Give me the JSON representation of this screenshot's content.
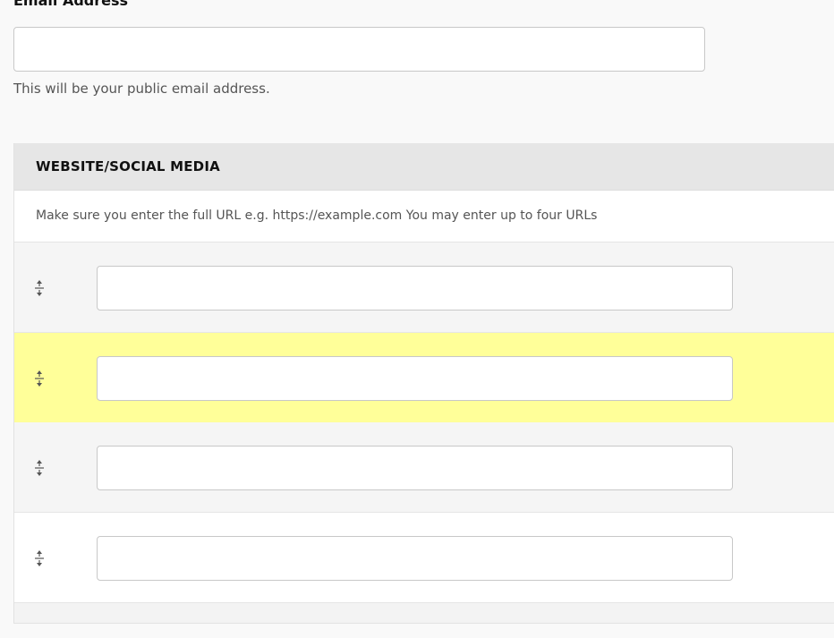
{
  "email": {
    "label": "Email Address",
    "value": "",
    "placeholder": "",
    "help_text": "This will be your public email address."
  },
  "social": {
    "title": "WEBSITE/SOCIAL MEDIA",
    "description": "Make sure you enter the full URL e.g. https://example.com You may enter up to four URLs",
    "rows": [
      {
        "value": "",
        "handle_icon": "drag-handle-icon",
        "highlighted": false
      },
      {
        "value": "",
        "handle_icon": "drag-handle-icon",
        "highlighted": true
      },
      {
        "value": "",
        "handle_icon": "drag-handle-icon",
        "highlighted": false
      },
      {
        "value": "",
        "handle_icon": "drag-handle-icon",
        "highlighted": false
      }
    ]
  },
  "colors": {
    "page_background": "#f9f9f9",
    "header_background": "#e6e6e6",
    "highlight_row": "#ffff99",
    "input_border": "#c8c8c8"
  }
}
